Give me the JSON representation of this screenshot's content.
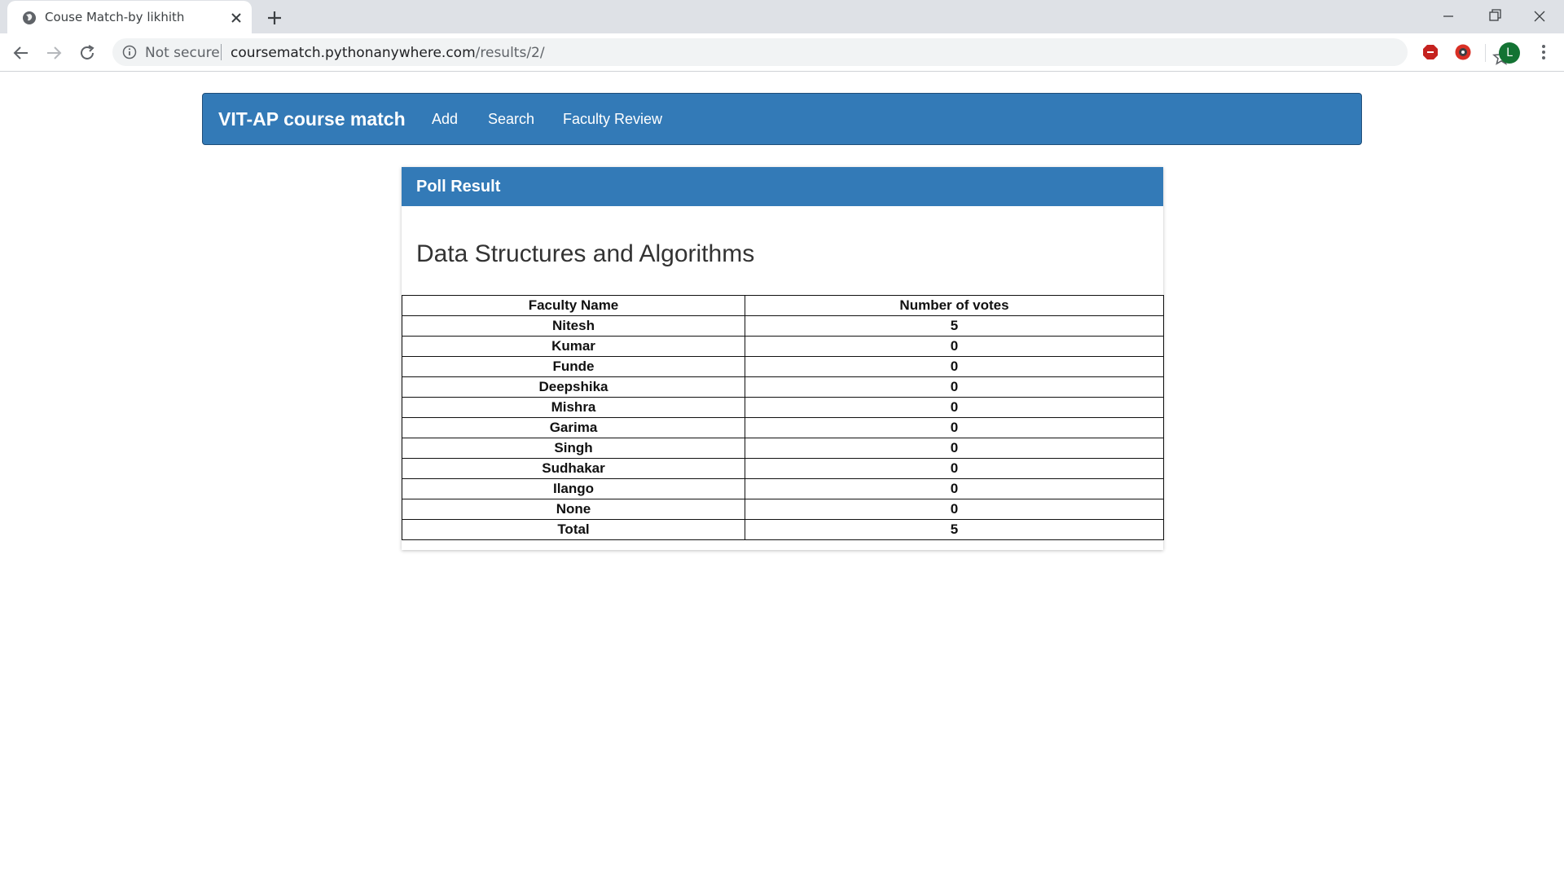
{
  "browser": {
    "tab_title": "Couse Match-by likhith",
    "security_label": "Not secure",
    "url_host": "coursematch.pythonanywhere.com",
    "url_path": "/results/2/",
    "profile_initial": "L",
    "accent_color": "#dee1e6"
  },
  "navbar": {
    "brand": "VIT-AP course match",
    "links": [
      "Add",
      "Search",
      "Faculty Review"
    ],
    "color": "#337ab7"
  },
  "panel": {
    "heading": "Poll Result",
    "course": "Data Structures and Algorithms"
  },
  "table": {
    "headers": [
      "Faculty Name",
      "Number of votes"
    ],
    "rows": [
      [
        "Nitesh",
        "5"
      ],
      [
        "Kumar",
        "0"
      ],
      [
        "Funde",
        "0"
      ],
      [
        "Deepshika",
        "0"
      ],
      [
        "Mishra",
        "0"
      ],
      [
        "Garima",
        "0"
      ],
      [
        "Singh",
        "0"
      ],
      [
        "Sudhakar",
        "0"
      ],
      [
        "Ilango",
        "0"
      ],
      [
        "None",
        "0"
      ],
      [
        "Total",
        "5"
      ]
    ]
  }
}
